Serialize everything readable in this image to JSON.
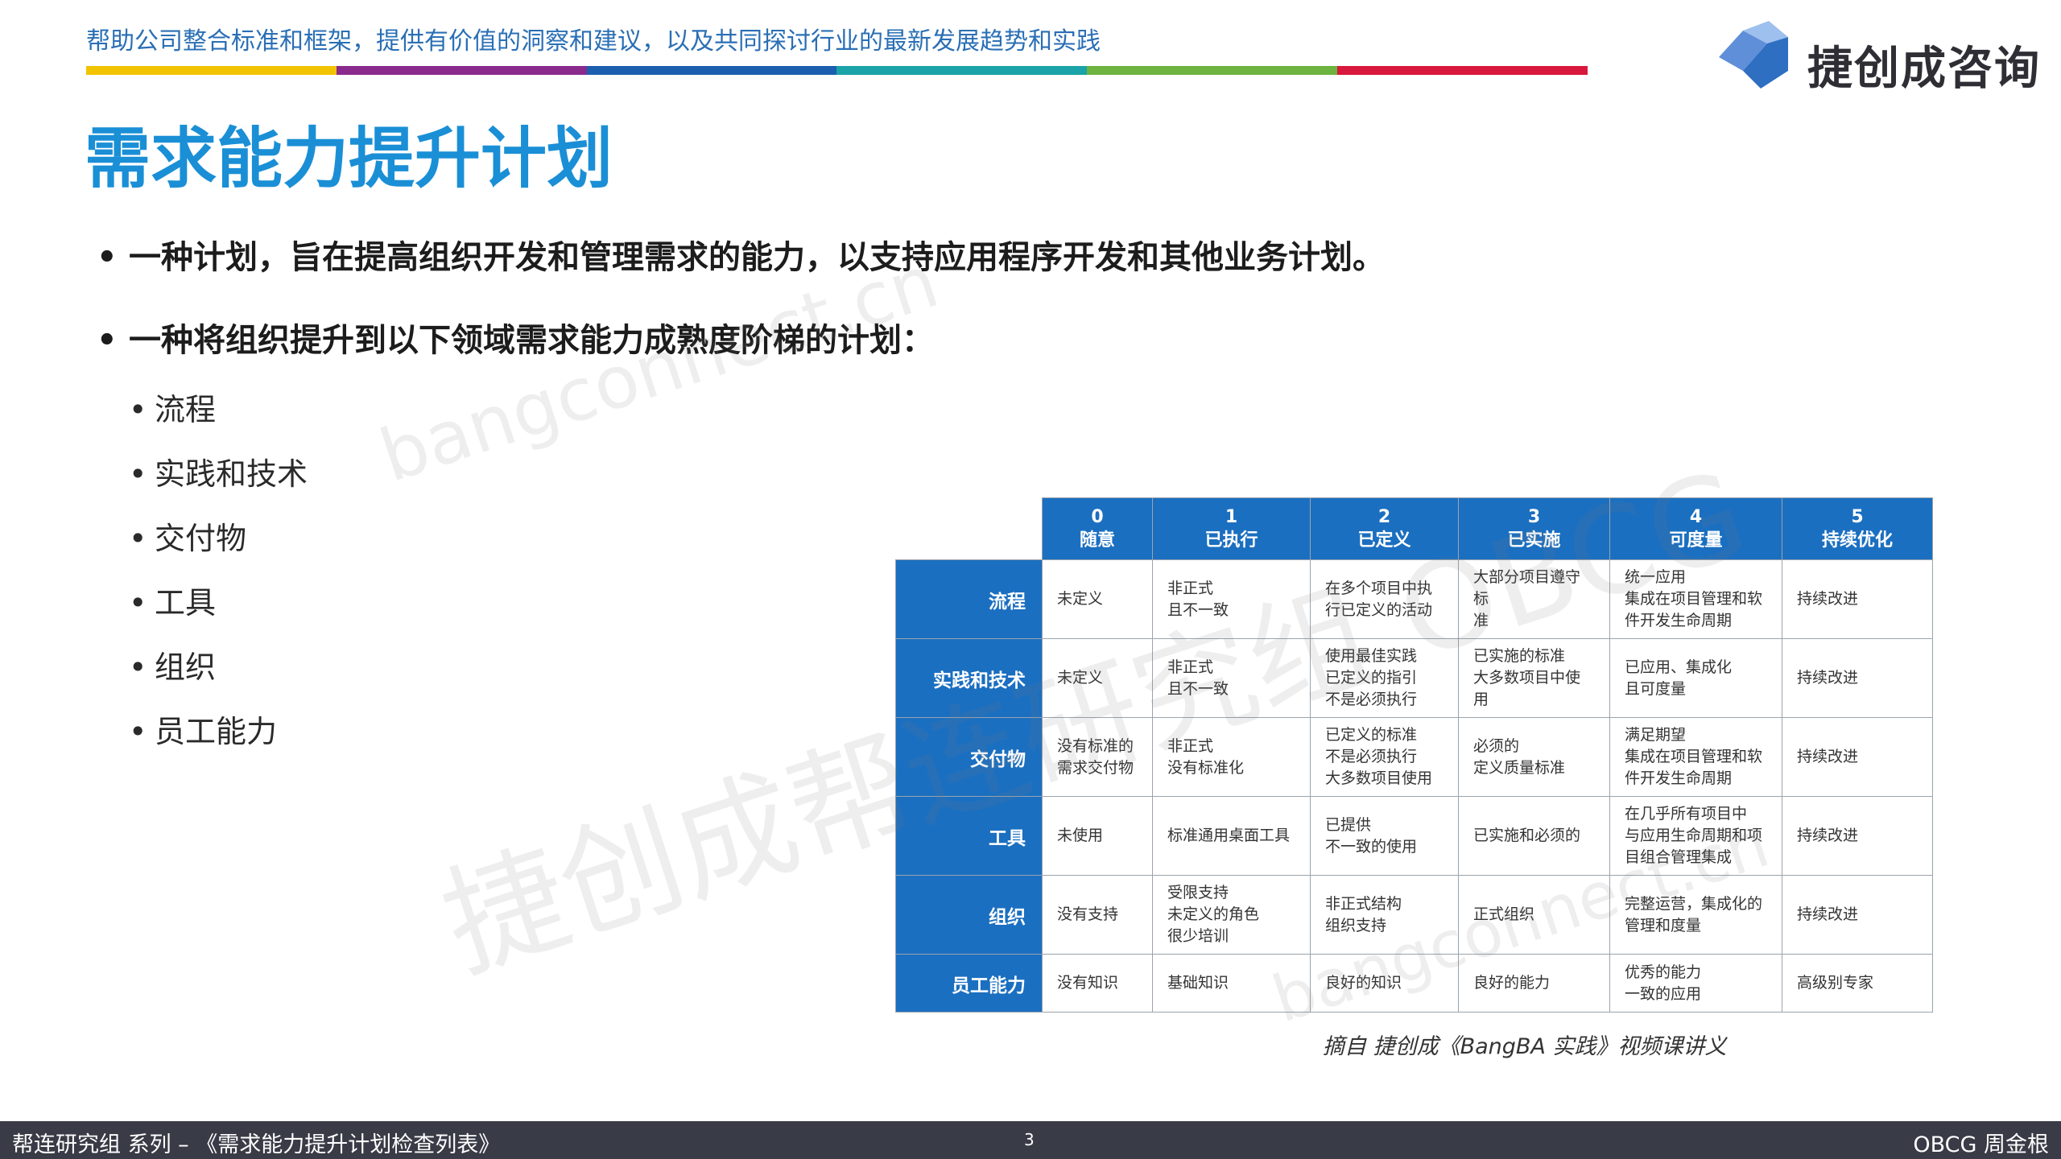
{
  "header": {
    "tagline": "帮助公司整合标准和框架，提供有价值的洞察和建议，以及共同探讨行业的最新发展趋势和实践",
    "stripe_colors": [
      "#f2c400",
      "#8a2a8c",
      "#1b5fae",
      "#1aa3a8",
      "#6cb33f",
      "#d8183c"
    ],
    "logo_text": "捷创成咨询",
    "logo_colors": [
      "#5f8fd8",
      "#9ec0ee",
      "#2f6fc2"
    ]
  },
  "title": "需求能力提升计划",
  "bullets": [
    "一种计划，旨在提高组织开发和管理需求的能力，以支持应用程序开发和其他业务计划。",
    "一种将组织提升到以下领域需求能力成熟度阶梯的计划："
  ],
  "sub_bullets": [
    "流程",
    "实践和技术",
    "交付物",
    "工具",
    "组织",
    "员工能力"
  ],
  "watermarks": [
    "捷创成帮连研究组 OBCG",
    "bangconnect.cn",
    "bangconnect.cn"
  ],
  "table": {
    "columns": [
      {
        "num": "0",
        "label": "随意"
      },
      {
        "num": "1",
        "label": "已执行"
      },
      {
        "num": "2",
        "label": "已定义"
      },
      {
        "num": "3",
        "label": "已实施"
      },
      {
        "num": "4",
        "label": "可度量"
      },
      {
        "num": "5",
        "label": "持续优化"
      }
    ],
    "rows": [
      {
        "label": "流程",
        "cells": [
          "未定义",
          "非正式\n且不一致",
          "在多个项目中执\n行已定义的活动",
          "大部分项目遵守标\n准",
          "统一应用\n集成在项目管理和软\n件开发生命周期",
          "持续改进"
        ]
      },
      {
        "label": "实践和技术",
        "cells": [
          "未定义",
          "非正式\n且不一致",
          "使用最佳实践\n已定义的指引\n不是必须执行",
          "已实施的标准\n大多数项目中使用",
          "已应用、集成化\n且可度量",
          "持续改进"
        ]
      },
      {
        "label": "交付物",
        "cells": [
          "没有标准的\n需求交付物",
          "非正式\n没有标准化",
          "已定义的标准\n不是必须执行\n大多数项目使用",
          "必须的\n定义质量标准",
          "满足期望\n集成在项目管理和软\n件开发生命周期",
          "持续改进"
        ]
      },
      {
        "label": "工具",
        "cells": [
          "未使用",
          "标准通用桌面工具",
          "已提供\n不一致的使用",
          "已实施和必须的",
          "在几乎所有项目中\n与应用生命周期和项\n目组合管理集成",
          "持续改进"
        ]
      },
      {
        "label": "组织",
        "cells": [
          "没有支持",
          "受限支持\n未定义的角色\n很少培训",
          "非正式结构\n组织支持",
          "正式组织",
          "完整运营，集成化的\n管理和度量",
          "持续改进"
        ]
      },
      {
        "label": "员工能力",
        "cells": [
          "没有知识",
          "基础知识",
          "良好的知识",
          "良好的能力",
          "优秀的能力\n一致的应用",
          "高级别专家"
        ]
      }
    ]
  },
  "caption": "摘自 捷创成《BangBA 实践》视频课讲义",
  "footer": {
    "left": "帮连研究组 系列 – 《需求能力提升计划检查列表》",
    "page": "3",
    "right": "OBCG 周金根"
  }
}
